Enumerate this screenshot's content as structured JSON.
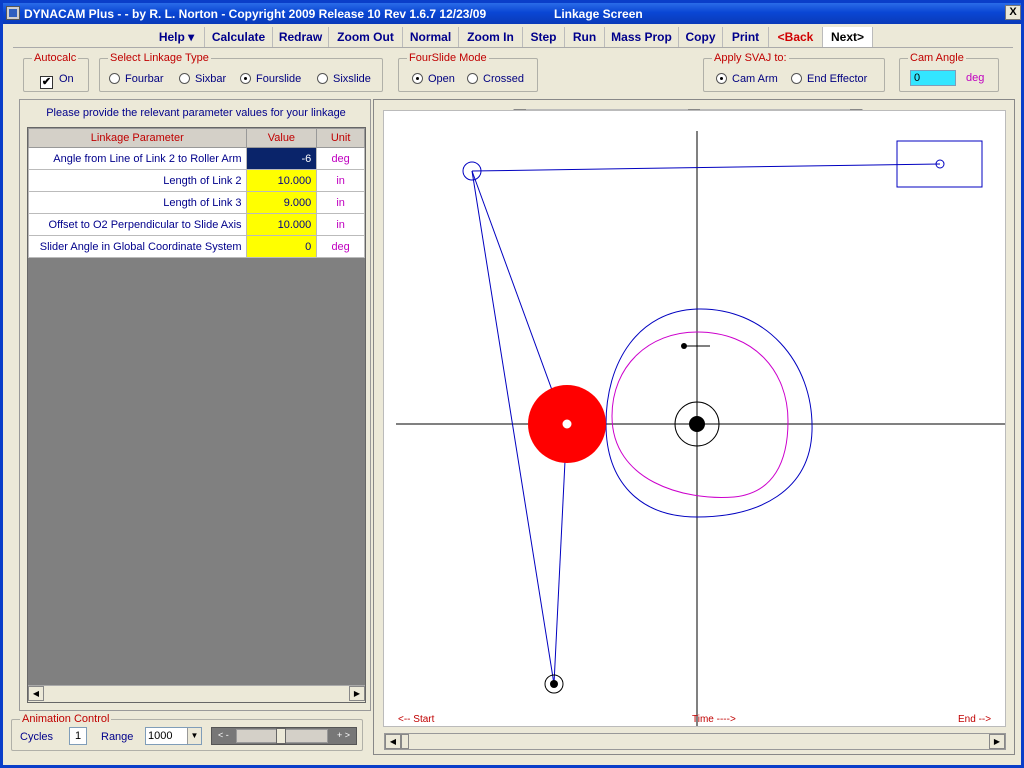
{
  "titlebar": {
    "title": "DYNACAM Plus -  - by R. L. Norton - Copyright 2009 Release 10  Rev 1.6.7  12/23/09",
    "screen": "Linkage Screen",
    "close": "X"
  },
  "toolbar": {
    "help": "Help  ▾",
    "calculate": "Calculate",
    "redraw": "Redraw",
    "zoom_out": "Zoom Out",
    "normal": "Normal",
    "zoom_in": "Zoom In",
    "step": "Step",
    "run": "Run",
    "mass_prop": "Mass Prop",
    "copy": "Copy",
    "print": "Print",
    "back": "<Back",
    "next": "Next>"
  },
  "autocalc": {
    "legend": "Autocalc",
    "label": "On",
    "checked": "✔"
  },
  "linkage_type": {
    "legend": "Select Linkage Type",
    "options": [
      "Fourbar",
      "Sixbar",
      "Fourslide",
      "Sixslide"
    ],
    "selected": "Fourslide"
  },
  "fourslide_mode": {
    "legend": "FourSlide Mode",
    "options": [
      "Open",
      "Crossed"
    ],
    "selected": "Open"
  },
  "svaj": {
    "legend": "Apply SVAJ to:",
    "options": [
      "Cam Arm",
      "End Effector"
    ],
    "selected": "Cam Arm"
  },
  "cam_angle": {
    "legend": "Cam Angle",
    "value": "0",
    "unit": "deg"
  },
  "params": {
    "prompt": "Please provide the relevant parameter values for your linkage",
    "headers": [
      "Linkage Parameter",
      "Value",
      "Unit"
    ],
    "rows": [
      {
        "name": "Angle from Line of Link 2 to Roller Arm",
        "value": "-6",
        "unit": "deg"
      },
      {
        "name": "Length of Link 2",
        "value": "10.000",
        "unit": "in"
      },
      {
        "name": "Length of Link 3",
        "value": "9.000",
        "unit": "in"
      },
      {
        "name": "Offset to O2 Perpendicular to Slide Axis",
        "value": "10.000",
        "unit": "in"
      },
      {
        "name": "Slider Angle in Global Coordinate System",
        "value": "0",
        "unit": "deg"
      }
    ]
  },
  "animation": {
    "legend": "Animation Control",
    "cycles_label": "Cycles",
    "cycles": "1",
    "range_label": "Range",
    "range": "1000",
    "slider_left": "< -",
    "slider_right": "+ >"
  },
  "canvas": {
    "start": "<-- Start",
    "time": "Time ---->",
    "end": "End -->"
  },
  "colors": {
    "link": "#0000c0",
    "roller": "#ff0000",
    "cam_inner": "#cc00cc",
    "label": "#c00000"
  }
}
